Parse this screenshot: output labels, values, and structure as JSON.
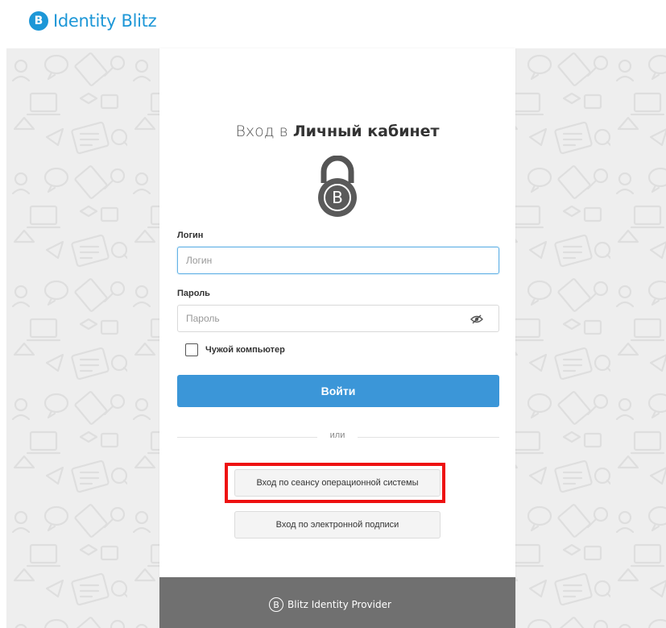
{
  "header": {
    "brand_logo_letter": "B",
    "brand_name": "Identity Blitz"
  },
  "login_form": {
    "title_prefix": "Вход в",
    "title_bold": "Личный кабинет",
    "lock_letter": "B",
    "login_label": "Логин",
    "login_placeholder": "Логин",
    "password_label": "Пароль",
    "password_placeholder": "Пароль",
    "remember_label": "Чужой компьютер",
    "remember_checked": false,
    "submit_label": "Войти",
    "divider_text": "или",
    "os_session_label": "Вход по сеансу операционной системы",
    "digital_signature_label": "Вход по электронной подписи"
  },
  "footer": {
    "logo_letter": "B",
    "name": "Blitz Identity Provider"
  },
  "colors": {
    "brand": "#1d97d7",
    "primary_button": "#3b96d8",
    "highlight": "#ee1111",
    "footer_bg": "#707070",
    "background": "#eeeeee"
  },
  "icons": {
    "brand": "blitz-logo-icon",
    "lock": "padlock-icon",
    "password_toggle": "eye-slash-icon",
    "footer": "blitz-logo-icon"
  }
}
